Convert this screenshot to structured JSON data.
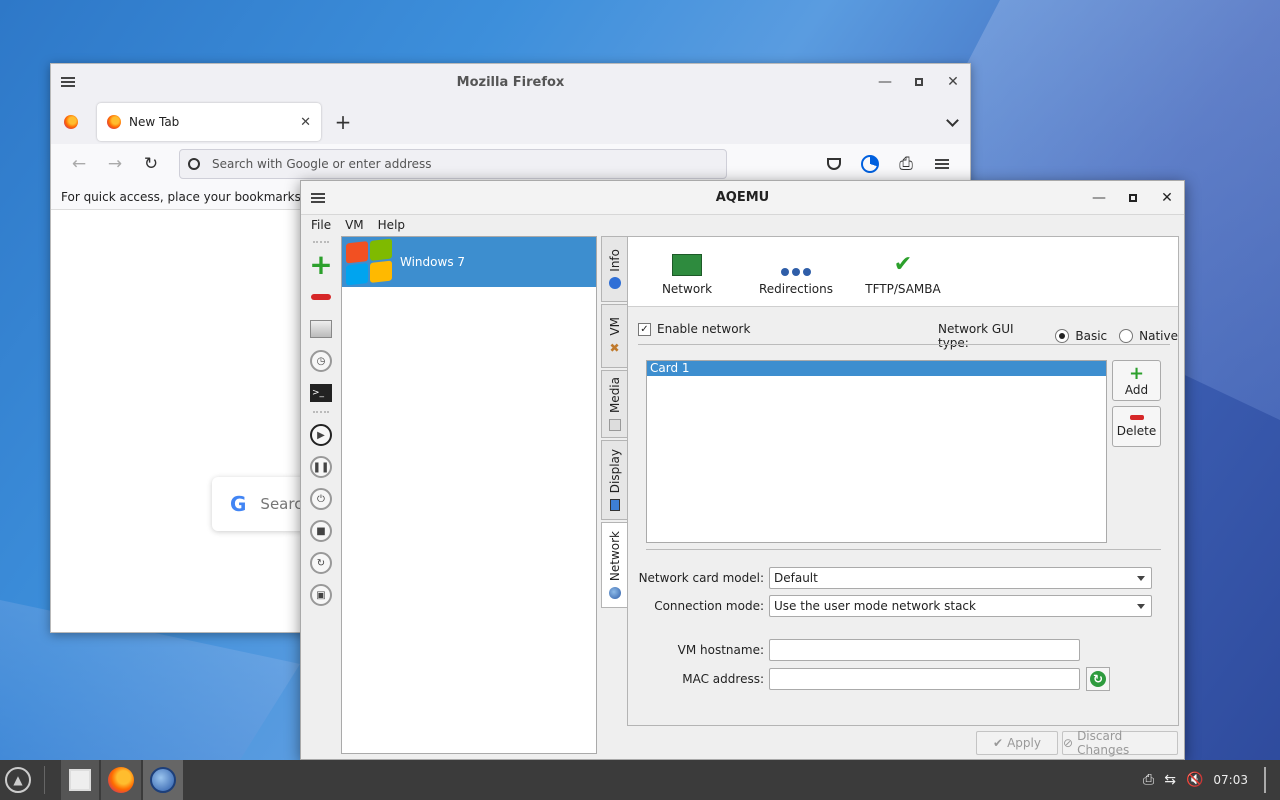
{
  "firefox": {
    "window_title": "Mozilla Firefox",
    "tab_label": "New Tab",
    "new_tab_symbol": "+",
    "url_placeholder": "Search with Google or enter address",
    "bookmarks_hint": "For quick access, place your bookmarks here o",
    "search_box_text": "Searc"
  },
  "aqemu": {
    "window_title": "AQEMU",
    "menu": [
      "File",
      "VM",
      "Help"
    ],
    "vm_list": [
      {
        "name": "Windows 7",
        "selected": true
      }
    ],
    "vertical_tabs": [
      "Info",
      "VM",
      "Media",
      "Display",
      "Network"
    ],
    "active_tab": "Network",
    "network": {
      "icon_strip": [
        "Network",
        "Redirections",
        "TFTP/SAMBA"
      ],
      "enable_network_label": "Enable network",
      "enable_network_checked": true,
      "gui_type_label": "Network GUI type:",
      "gui_type_options": [
        "Basic",
        "Native"
      ],
      "gui_type_selected": "Basic",
      "cards": [
        "Card 1"
      ],
      "add_label": "Add",
      "delete_label": "Delete",
      "card_model_label": "Network card model:",
      "card_model_value": "Default",
      "connection_mode_label": "Connection mode:",
      "connection_mode_value": "Use the user mode network stack",
      "hostname_label": "VM hostname:",
      "hostname_value": "",
      "mac_label": "MAC address:",
      "mac_value": ""
    },
    "apply_label": "Apply",
    "discard_label": "Discard Changes"
  },
  "taskbar": {
    "clock": "07:03"
  },
  "colors": {
    "selection_blue": "#3d8ecf",
    "taskbar_bg": "#3b3b3b"
  }
}
